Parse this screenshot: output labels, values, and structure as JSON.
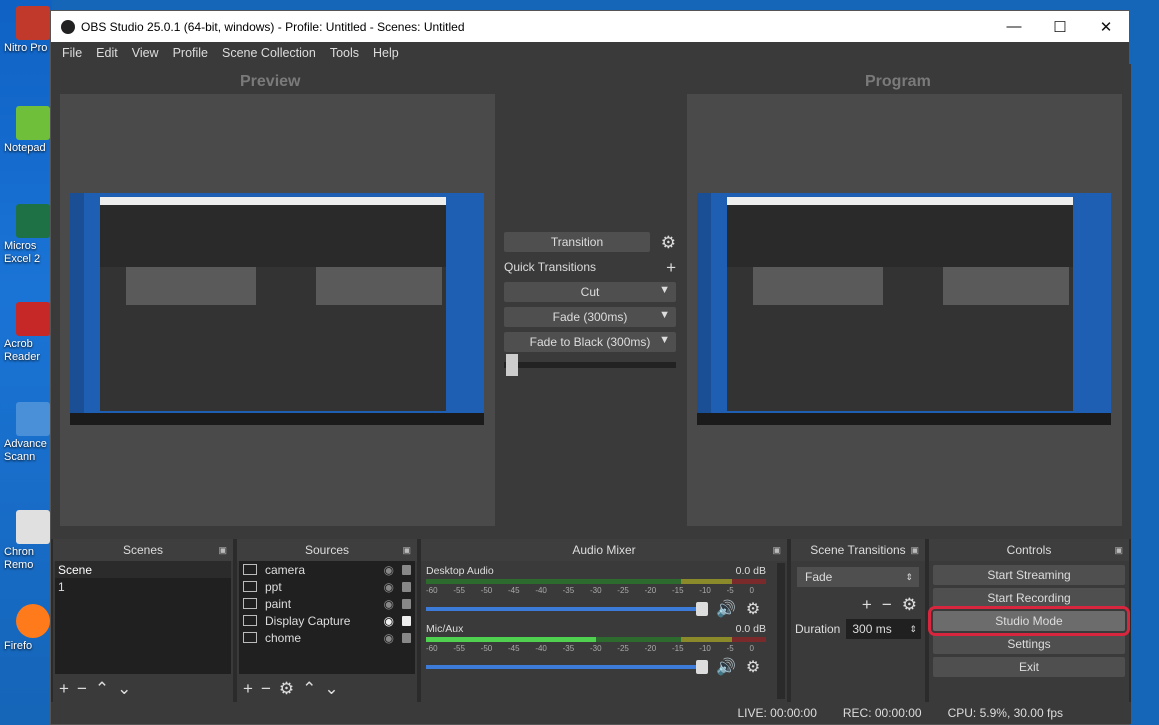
{
  "desktop": {
    "icons": [
      {
        "label": "Nitro Pro",
        "color": "#c0392b"
      },
      {
        "label": "Notepad",
        "color": "#6fbf3a"
      },
      {
        "label": "Micros Excel 2",
        "color": "#1e7145"
      },
      {
        "label": "Acrob Reader",
        "color": "#c62828"
      },
      {
        "label": "Advance Scann",
        "color": "#4a90d9"
      },
      {
        "label": "Chron Remo",
        "color": "#e0e0e0"
      },
      {
        "label": "Firefo",
        "color": "#ff7a1a"
      }
    ]
  },
  "window": {
    "title": "OBS Studio 25.0.1 (64-bit, windows) - Profile: Untitled - Scenes: Untitled",
    "controls": {
      "minimize": "—",
      "maximize": "☐",
      "close": "✕"
    }
  },
  "menu": [
    "File",
    "Edit",
    "View",
    "Profile",
    "Scene Collection",
    "Tools",
    "Help"
  ],
  "preview": {
    "title": "Preview"
  },
  "program": {
    "title": "Program"
  },
  "transition_panel": {
    "transition_label": "Transition",
    "quick_transitions_label": "Quick Transitions",
    "items": [
      "Cut",
      "Fade (300ms)",
      "Fade to Black (300ms)"
    ],
    "slider_value": 0
  },
  "docks": {
    "scenes": {
      "title": "Scenes",
      "items": [
        "Scene",
        "1"
      ],
      "selected": "Scene"
    },
    "sources": {
      "title": "Sources",
      "items": [
        "camera",
        "ppt",
        "paint",
        "Display Capture",
        "chome"
      ]
    },
    "audio_mixer": {
      "title": "Audio Mixer",
      "channels": [
        {
          "name": "Desktop Audio",
          "db": "0.0 dB",
          "volume": 1.0
        },
        {
          "name": "Mic/Aux",
          "db": "0.0 dB",
          "volume": 1.0
        }
      ],
      "scale": [
        "-60",
        "-55",
        "-50",
        "-45",
        "-40",
        "-35",
        "-30",
        "-25",
        "-20",
        "-15",
        "-10",
        "-5",
        "0"
      ]
    },
    "scene_transitions": {
      "title": "Scene Transitions",
      "selected": "Fade",
      "duration_label": "Duration",
      "duration_value": "300 ms"
    },
    "controls": {
      "title": "Controls",
      "buttons": [
        "Start Streaming",
        "Start Recording",
        "Studio Mode",
        "Settings",
        "Exit"
      ]
    }
  },
  "status": {
    "live": "LIVE: 00:00:00",
    "rec": "REC: 00:00:00",
    "cpu": "CPU: 5.9%, 30.00 fps"
  }
}
